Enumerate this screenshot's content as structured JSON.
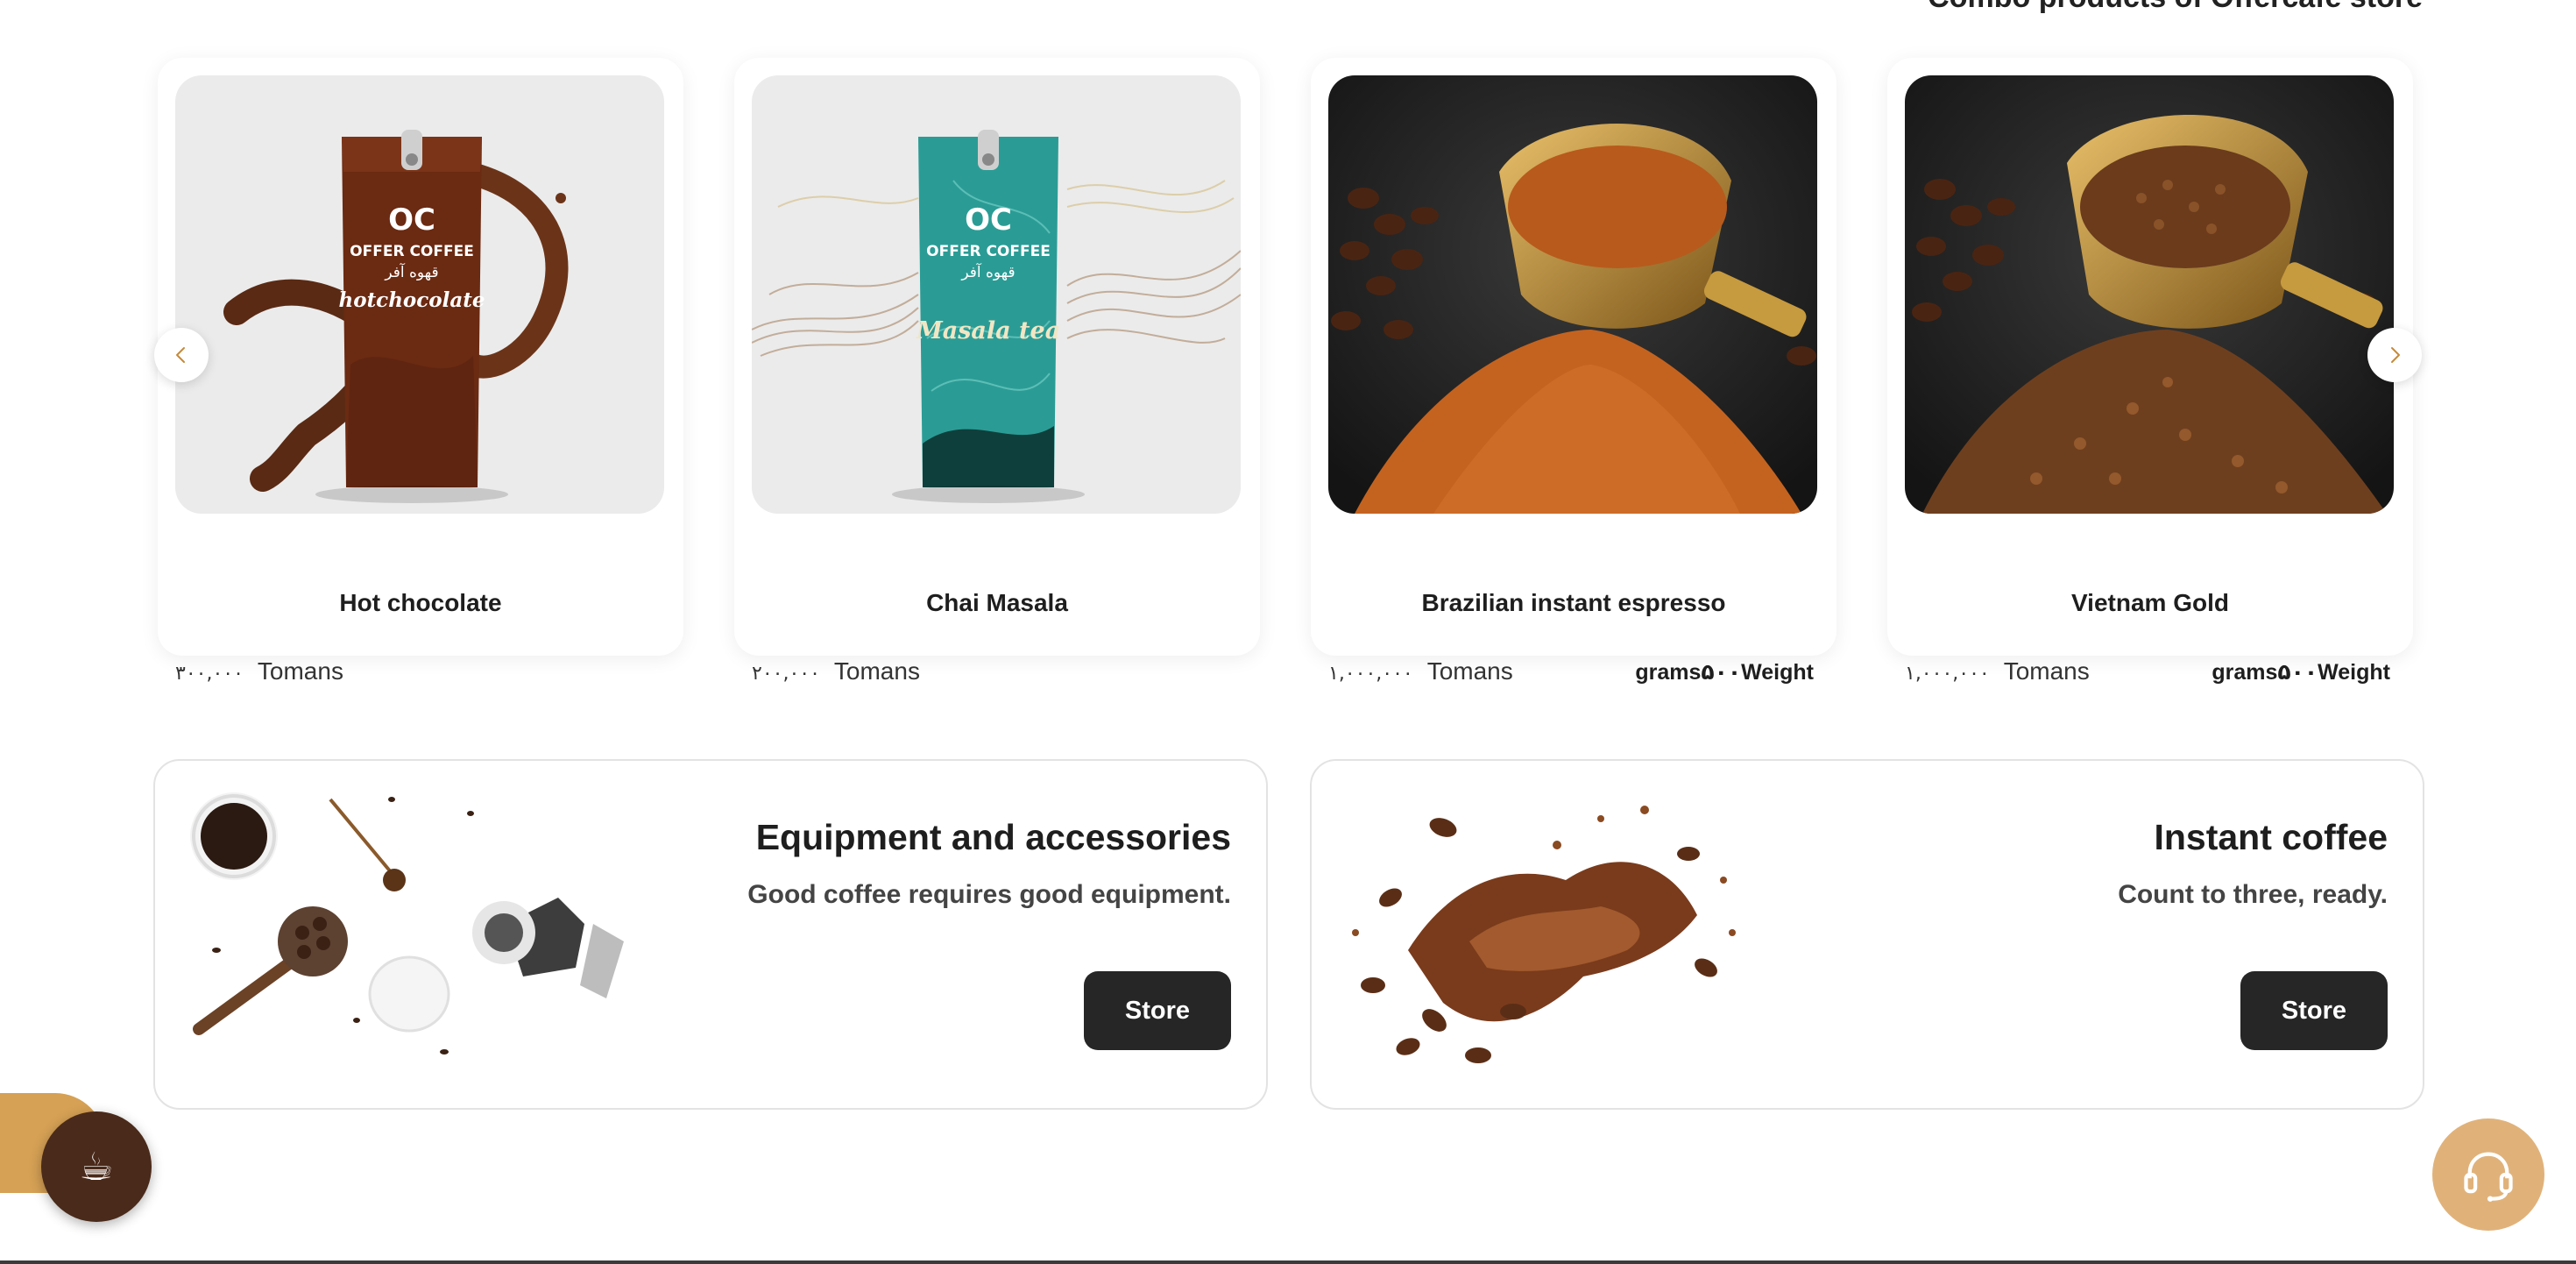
{
  "section": {
    "title": "Combo products of Offercafe store"
  },
  "products": [
    {
      "name": "Hot chocolate",
      "price": "۳۰۰,۰۰۰",
      "currency": "Tomans",
      "weight": "",
      "image": "hot-chocolate-package",
      "packageColor": "#6b2a12"
    },
    {
      "name": "Chai Masala",
      "price": "۲۰۰,۰۰۰",
      "currency": "Tomans",
      "weight": "",
      "image": "chai-masala-package",
      "packageColor": "#2a9c95"
    },
    {
      "name": "Brazilian instant espresso",
      "price": "۱,۰۰۰,۰۰۰",
      "currency": "Tomans",
      "weight": "grams۵۰۰Weight",
      "image": "espresso-powder-scoop",
      "packageColor": "#c9651f"
    },
    {
      "name": "Vietnam Gold",
      "price": "۱,۰۰۰,۰۰۰",
      "currency": "Tomans",
      "weight": "grams۵۰۰Weight",
      "image": "coffee-granules-scoop",
      "packageColor": "#7a4a22"
    }
  ],
  "packageText": {
    "logo": "OC",
    "brand": "OFFER COFFEE",
    "brandFa": "قهوه آفر",
    "hotLabel": "hotchocolate",
    "chaiLabel": "Masala tea"
  },
  "banners": [
    {
      "title": "Equipment and accessories",
      "subtitle": "Good coffee requires good equipment.",
      "button": "Store",
      "image": "coffee-equipment"
    },
    {
      "title": "Instant coffee",
      "subtitle": "Count to three, ready.",
      "button": "Store",
      "image": "coffee-splash"
    }
  ],
  "icons": {
    "prev": "chevron-left-icon",
    "next": "chevron-right-icon",
    "cup": "coffee-cup-icon",
    "support": "headset-icon"
  },
  "colors": {
    "accent": "#d6a155",
    "buttonDark": "#262626",
    "cupButton": "#4a2a1a",
    "support": "#e0b27a"
  }
}
